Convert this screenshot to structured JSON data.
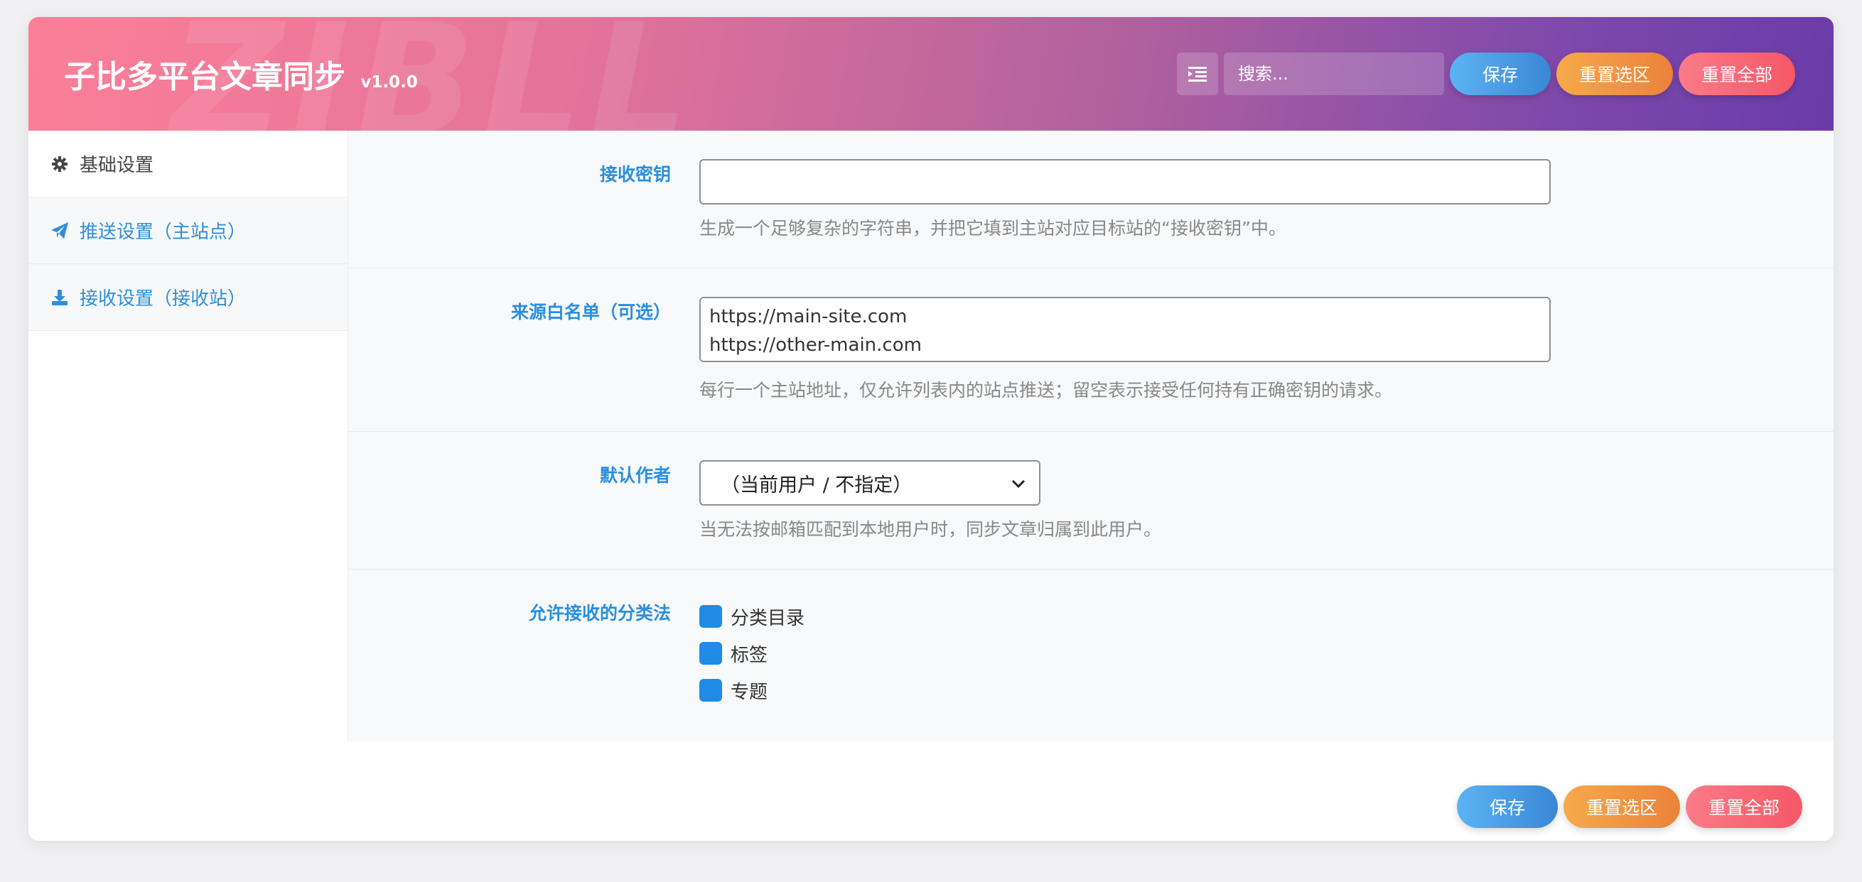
{
  "header": {
    "title": "子比多平台文章同步",
    "version": "v1.0.0",
    "watermark": "ZIBLL",
    "search_placeholder": "搜索...",
    "save_label": "保存",
    "reset_section_label": "重置选区",
    "reset_all_label": "重置全部",
    "expand_icon": "indent-icon"
  },
  "sidebar": {
    "items": [
      {
        "label": "基础设置",
        "icon": "gear-icon"
      },
      {
        "label": "推送设置（主站点）",
        "icon": "paper-plane-icon"
      },
      {
        "label": "接收设置（接收站）",
        "icon": "download-icon"
      }
    ]
  },
  "main": {
    "receive_key": {
      "label": "接收密钥",
      "value": "",
      "help": "生成一个足够复杂的字符串，并把它填到主站对应目标站的“接收密钥”中。"
    },
    "whitelist": {
      "label": "来源白名单（可选）",
      "value": "https://main-site.com\nhttps://other-main.com",
      "help": "每行一个主站地址，仅允许列表内的站点推送；留空表示接受任何持有正确密钥的请求。"
    },
    "default_author": {
      "label": "默认作者",
      "selected": "（当前用户 / 不指定）",
      "help": "当无法按邮箱匹配到本地用户时，同步文章归属到此用户。"
    },
    "taxonomies": {
      "label": "允许接收的分类法",
      "options": [
        {
          "label": "分类目录",
          "checked": true
        },
        {
          "label": "标签",
          "checked": true
        },
        {
          "label": "专题",
          "checked": true
        }
      ]
    }
  },
  "footer": {
    "save_label": "保存",
    "reset_section_label": "重置选区",
    "reset_all_label": "重置全部"
  },
  "colors": {
    "accent_blue": "#2b8fde",
    "checkbox_blue": "#1f8be6",
    "header_gradient_start": "#fb7f97",
    "header_gradient_end": "#6a3ba8"
  }
}
